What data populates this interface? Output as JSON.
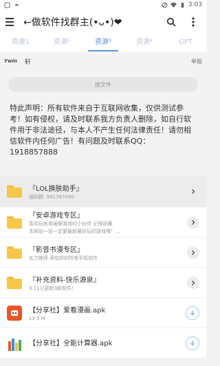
{
  "status_bar": {
    "time": "3:03"
  },
  "app_bar": {
    "title": "←做软件找群主(•ᴗ•)❤"
  },
  "tabs": [
    {
      "label": "资源1"
    },
    {
      "label": "资源²"
    },
    {
      "label": "资源³"
    },
    {
      "label": "资源⁴"
    },
    {
      "label": "GPT"
    }
  ],
  "user_row": {
    "logo": "Ywin",
    "name": "轩",
    "report": "举报"
  },
  "search": {
    "placeholder": "搜文件"
  },
  "notice": "特此声明：所有软件来自于互联网收集，仅供测试参考！如有侵权，请及时联系我方负责人删除，如自行软件用于非法途径，与本人不产生任何法律责任！请勿相信软件内任何广告！有问题及时联系QQ：1918857888",
  "items": [
    {
      "title": "『LOL换肤助手』",
      "subtitle": "通知群: 991787490",
      "subtitle2": ""
    },
    {
      "title": "『安卓游戏专区』",
      "subtitle": "喜欢玩各类破解游戏的小伙伴 记得收藏",
      "subtitle2": "本网站一站一定要最新最好玩的游戏哦！..."
    },
    {
      "title": "『影音书漫专区』",
      "subtitle": "实力推荐·承包你的所有手机软件",
      "subtitle2": ""
    },
    {
      "title": "『补充资料-快乐源泉』",
      "subtitle": "8.11已更新3款软件！",
      "subtitle2": ""
    }
  ],
  "files": [
    {
      "name": "【分享社】爱看漫画.apk",
      "size": "13.5 M"
    },
    {
      "name": "【分享社】全能计算器.apk",
      "size": ""
    }
  ],
  "colors": {
    "accent": "#5d8ee0",
    "folder": "#f7c748",
    "inactive_tab": "#b8c4dc"
  }
}
